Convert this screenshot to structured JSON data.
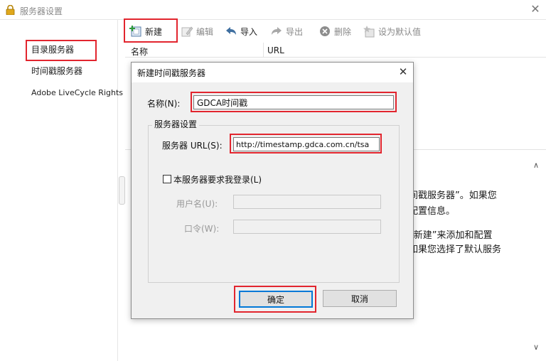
{
  "window": {
    "title": "服务器设置"
  },
  "sidebar": {
    "items": [
      {
        "label": "目录服务器"
      },
      {
        "label": "时间戳服务器"
      },
      {
        "label": "Adobe LiveCycle Rights"
      }
    ],
    "selected_index": 1
  },
  "toolbar": {
    "new_label": "新建",
    "edit_label": "编辑",
    "import_label": "导入",
    "export_label": "导出",
    "delete_label": "删除",
    "set_default_label": "设为默认值"
  },
  "list": {
    "columns": [
      "名称",
      "URL"
    ]
  },
  "description": {
    "lines": [
      "间戳服务器”。如果您",
      "配置信息。",
      "“新建”来添加和配置",
      "如果您选择了默认服务"
    ]
  },
  "dialog": {
    "title": "新建时间戳服务器",
    "name_label": "名称(N):",
    "name_value": "GDCA时间戳",
    "group_label": "服务器设置",
    "url_label": "服务器 URL(S):",
    "url_value": "http://timestamp.gdca.com.cn/tsa",
    "login_checkbox_label": "本服务器要求我登录(L)",
    "login_checked": false,
    "username_label": "用户名(U):",
    "password_label": "口令(W):",
    "ok_label": "确定",
    "cancel_label": "取消"
  },
  "colors": {
    "highlight": "#e2252e",
    "focus_border": "#0078d7",
    "dialog_bg": "#f0f0f0"
  }
}
